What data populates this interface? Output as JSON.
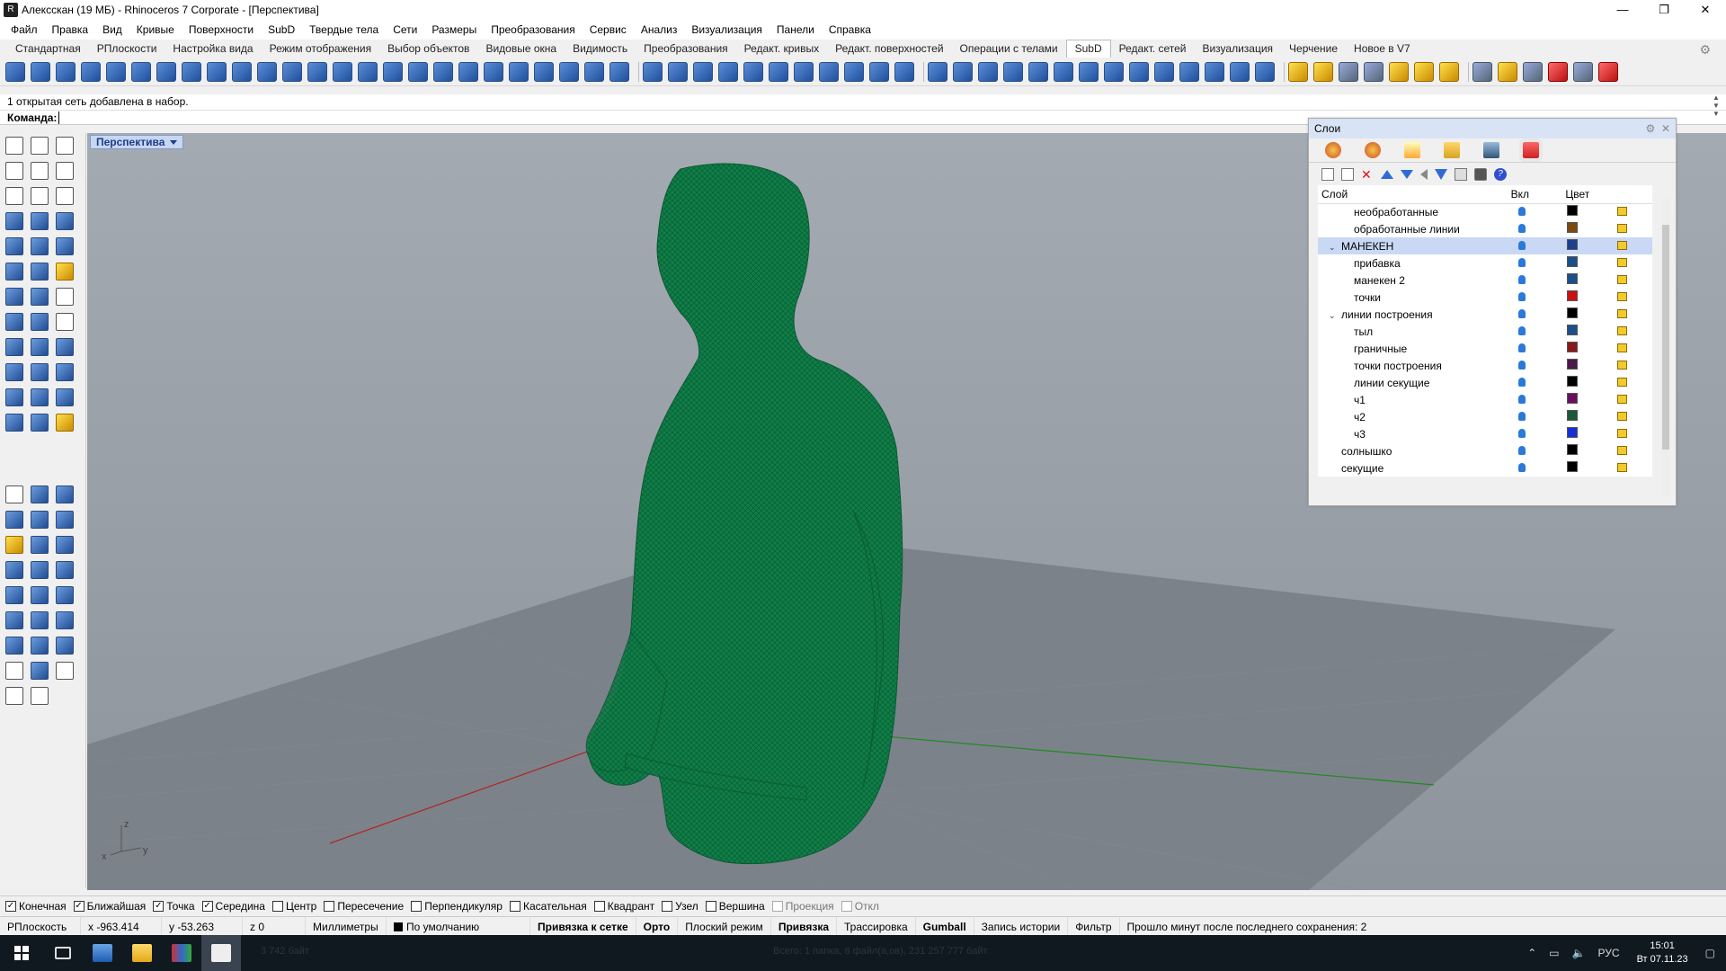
{
  "window": {
    "title": "Алексскан (19 МБ) - Rhinoceros 7 Corporate - [Перспектива]",
    "buttons": {
      "minimize": "—",
      "maximize": "❐",
      "close": "✕"
    }
  },
  "menu": [
    "Файл",
    "Правка",
    "Вид",
    "Кривые",
    "Поверхности",
    "SubD",
    "Твердые тела",
    "Сети",
    "Размеры",
    "Преобразования",
    "Сервис",
    "Анализ",
    "Визуализация",
    "Панели",
    "Справка"
  ],
  "toolbar_tabs": {
    "items": [
      "Стандартная",
      "РПлоскости",
      "Настройка вида",
      "Режим отображения",
      "Выбор объектов",
      "Видовые окна",
      "Видимость",
      "Преобразования",
      "Редакт. кривых",
      "Редакт. поверхностей",
      "Операции с телами",
      "SubD",
      "Редакт. сетей",
      "Визуализация",
      "Черчение",
      "Новое в V7"
    ],
    "active_index": 11
  },
  "command": {
    "history": "1 открытая сеть добавлена в набор.",
    "prompt_label": "Команда:",
    "value": ""
  },
  "viewport": {
    "label": "Перспектива",
    "mesh_color": "#0e7a45",
    "axis_labels": {
      "z": "z",
      "x": "x",
      "y": "y"
    }
  },
  "layers_panel": {
    "title": "Слои",
    "columns": {
      "name": "Слой",
      "on": "Вкл",
      "color": "Цвет"
    },
    "rows": [
      {
        "name": "необработанные",
        "indent": 1,
        "color": "#000000",
        "selected": false,
        "expander": ""
      },
      {
        "name": "обработанные линии",
        "indent": 1,
        "color": "#7a4a10",
        "selected": false,
        "expander": ""
      },
      {
        "name": "МАНЕКЕН",
        "indent": 0,
        "color": "#1c3f8f",
        "selected": true,
        "expander": "⌄"
      },
      {
        "name": "прибавка",
        "indent": 1,
        "color": "#1c4f8a",
        "selected": false,
        "expander": ""
      },
      {
        "name": "манекен 2",
        "indent": 1,
        "color": "#1c4f8a",
        "selected": false,
        "expander": ""
      },
      {
        "name": "точки",
        "indent": 1,
        "color": "#cc1111",
        "selected": false,
        "expander": ""
      },
      {
        "name": "линии построения",
        "indent": 0,
        "color": "#000000",
        "selected": false,
        "expander": "⌄"
      },
      {
        "name": "тыл",
        "indent": 1,
        "color": "#1c4f8a",
        "selected": false,
        "expander": ""
      },
      {
        "name": "граничные",
        "indent": 1,
        "color": "#8a1a1a",
        "selected": false,
        "expander": ""
      },
      {
        "name": "точки построения",
        "indent": 1,
        "color": "#4a1a4a",
        "selected": false,
        "expander": ""
      },
      {
        "name": "линии секущие",
        "indent": 1,
        "color": "#000000",
        "selected": false,
        "expander": ""
      },
      {
        "name": "ч1",
        "indent": 1,
        "color": "#6a1060",
        "selected": false,
        "expander": ""
      },
      {
        "name": "ч2",
        "indent": 1,
        "color": "#1a5a3a",
        "selected": false,
        "expander": ""
      },
      {
        "name": "ч3",
        "indent": 1,
        "color": "#1530d8",
        "selected": false,
        "expander": ""
      },
      {
        "name": "солнышко",
        "indent": 0,
        "color": "#000000",
        "selected": false,
        "expander": ""
      },
      {
        "name": "секущие",
        "indent": 0,
        "color": "#000000",
        "selected": false,
        "expander": ""
      }
    ]
  },
  "osnaps": [
    {
      "label": "Конечная",
      "checked": true,
      "enabled": true
    },
    {
      "label": "Ближайшая",
      "checked": true,
      "enabled": true
    },
    {
      "label": "Точка",
      "checked": true,
      "enabled": true
    },
    {
      "label": "Середина",
      "checked": true,
      "enabled": true
    },
    {
      "label": "Центр",
      "checked": false,
      "enabled": true
    },
    {
      "label": "Пересечение",
      "checked": false,
      "enabled": true
    },
    {
      "label": "Перпендикуляр",
      "checked": false,
      "enabled": true
    },
    {
      "label": "Касательная",
      "checked": false,
      "enabled": true
    },
    {
      "label": "Квадрант",
      "checked": false,
      "enabled": true
    },
    {
      "label": "Узел",
      "checked": false,
      "enabled": true
    },
    {
      "label": "Вершина",
      "checked": false,
      "enabled": true
    },
    {
      "label": "Проекция",
      "checked": false,
      "enabled": false
    },
    {
      "label": "Откл",
      "checked": false,
      "enabled": false
    }
  ],
  "statusbar": {
    "cplane": "РПлоскость",
    "x": "x -963.414",
    "y": "y -53.263",
    "z": "z 0",
    "units": "Миллиметры",
    "layer": "По умолчанию",
    "toggles": [
      {
        "label": "Привязка к сетке",
        "bold": true
      },
      {
        "label": "Орто",
        "bold": true
      },
      {
        "label": "Плоский режим",
        "bold": false
      },
      {
        "label": "Привязка",
        "bold": true
      },
      {
        "label": "Трассировка",
        "bold": false
      },
      {
        "label": "Gumball",
        "bold": true
      },
      {
        "label": "Запись истории",
        "bold": false
      },
      {
        "label": "Фильтр",
        "bold": false
      }
    ],
    "message": "Прошло минут после последнего сохранения: 2"
  },
  "taskbar": {
    "ghost_left": "3 742 байт",
    "ghost_center": "Всего: 1 папка, 8 файл(а,ов), 231 257 777 байт",
    "lang": "РУС",
    "time": "15:01",
    "date": "Вт 07.11.23"
  }
}
